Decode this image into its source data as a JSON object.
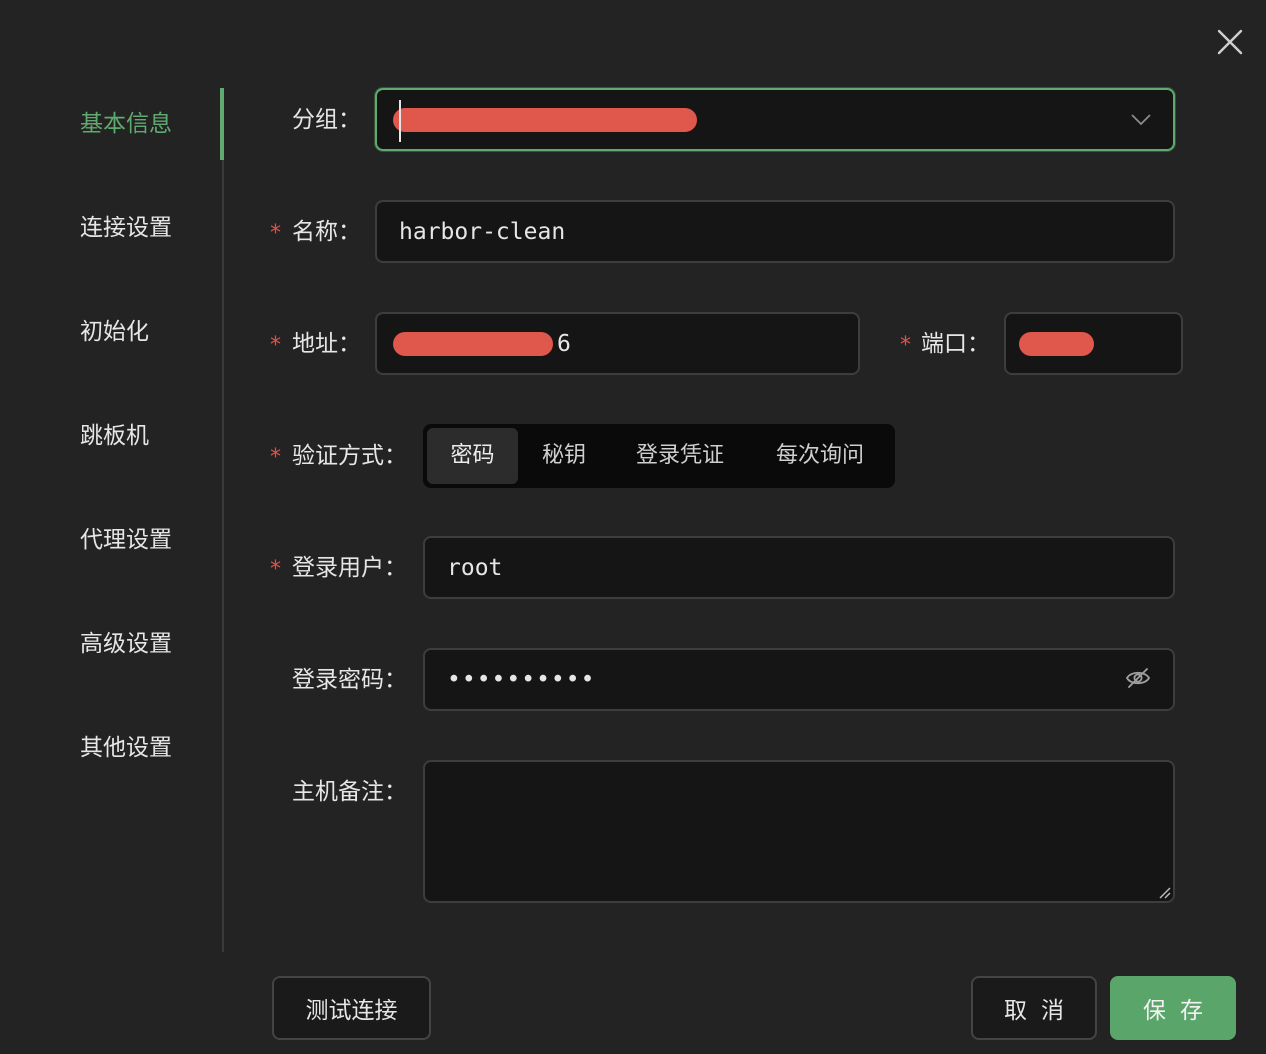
{
  "sidebar": {
    "items": [
      {
        "label": "基本信息"
      },
      {
        "label": "连接设置"
      },
      {
        "label": "初始化"
      },
      {
        "label": "跳板机"
      },
      {
        "label": "代理设置"
      },
      {
        "label": "高级设置"
      },
      {
        "label": "其他设置"
      }
    ]
  },
  "form": {
    "group": {
      "label": "分组："
    },
    "name": {
      "label": "名称：",
      "value": "harbor-clean",
      "required_mark": "*"
    },
    "address": {
      "label": "地址：",
      "value_suffix": "6",
      "required_mark": "*"
    },
    "port": {
      "label": "端口：",
      "required_mark": "*"
    },
    "auth": {
      "label": "验证方式：",
      "required_mark": "*",
      "options": [
        {
          "label": "密码"
        },
        {
          "label": "秘钥"
        },
        {
          "label": "登录凭证"
        },
        {
          "label": "每次询问"
        }
      ],
      "selected": "密码"
    },
    "user": {
      "label": "登录用户：",
      "value": "root",
      "required_mark": "*"
    },
    "password": {
      "label": "登录密码：",
      "value": "••••••••••"
    },
    "note": {
      "label": "主机备注："
    }
  },
  "footer": {
    "test_label": "测试连接",
    "cancel_label": "取消",
    "save_label": "保存"
  },
  "colors": {
    "accent": "#5faa6e",
    "required": "#d9564a",
    "redaction": "#e0574b",
    "background": "#232323"
  }
}
